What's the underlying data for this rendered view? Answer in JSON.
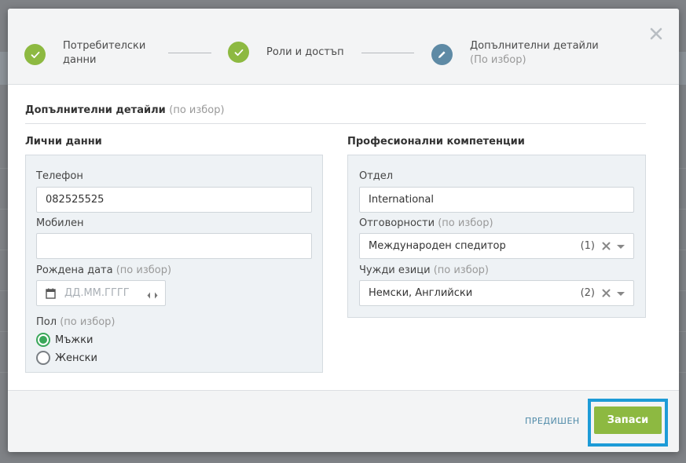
{
  "wizard": {
    "steps": [
      {
        "title": "Потребителски",
        "title2": "данни",
        "state": "done"
      },
      {
        "title": "Роли и достъп",
        "state": "done"
      },
      {
        "title": "Допълнителни детайли",
        "subtitle": "(По избор)",
        "state": "current"
      }
    ]
  },
  "section": {
    "title": "Допълнителни детайли",
    "optional": "(по избор)"
  },
  "personal": {
    "title": "Лични данни",
    "phone_label": "Телефон",
    "phone_value": "082525525",
    "mobile_label": "Мобилен",
    "mobile_value": "",
    "birth_label": "Рождена дата",
    "birth_optional": "(по избор)",
    "birth_placeholder": "ДД.ММ.ГГГГ",
    "gender_label": "Пол",
    "gender_optional": "(по избор)",
    "gender_options": [
      {
        "label": "Мъжки",
        "checked": true
      },
      {
        "label": "Женски",
        "checked": false
      }
    ]
  },
  "professional": {
    "title": "Професионални компетенции",
    "department_label": "Отдел",
    "department_value": "International",
    "responsibilities_label": "Отговорности",
    "responsibilities_optional": "(по избор)",
    "responsibilities_value": "Международен спедитор",
    "responsibilities_count": "(1)",
    "languages_label": "Чужди езици",
    "languages_optional": "(по избор)",
    "languages_value": "Немски, Английски",
    "languages_count": "(2)"
  },
  "footer": {
    "prev_label": "ПРЕДИШЕН",
    "save_label": "Запаси"
  },
  "colors": {
    "success": "#8db941",
    "current_step": "#5e8aa5",
    "highlight": "#1d9bd7",
    "radio_checked": "#3aa75a"
  }
}
